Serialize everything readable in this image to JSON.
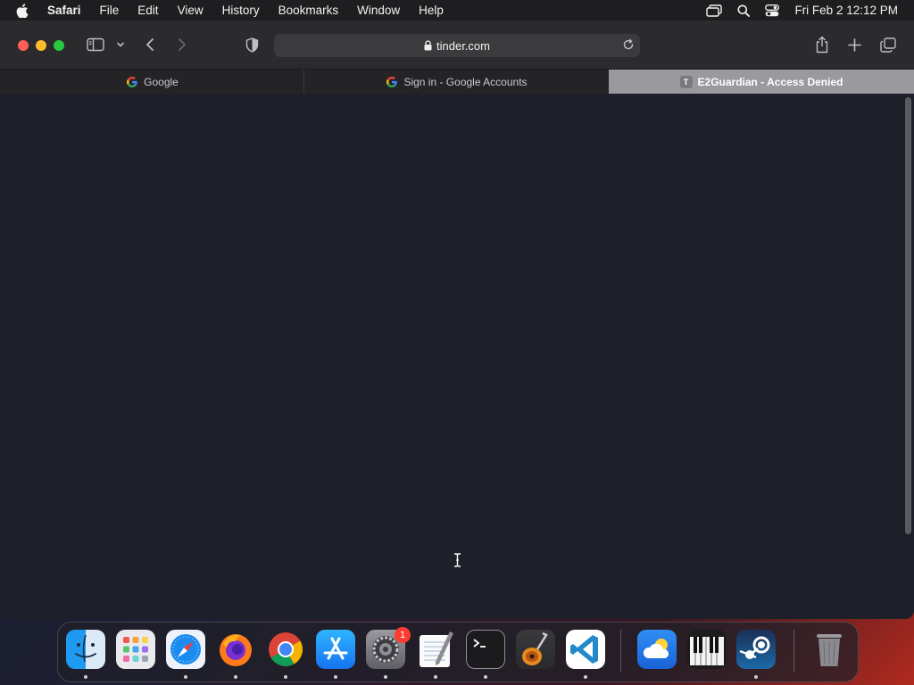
{
  "menubar": {
    "app_name": "Safari",
    "items": [
      "File",
      "Edit",
      "View",
      "History",
      "Bookmarks",
      "Window",
      "Help"
    ],
    "clock": "Fri Feb 2  12:12 PM"
  },
  "toolbar": {
    "url": "tinder.com"
  },
  "tabs": [
    {
      "title": "Google",
      "favicon": "google-icon",
      "active": false
    },
    {
      "title": "Sign in - Google Accounts",
      "favicon": "google-icon",
      "active": false
    },
    {
      "title": "E2Guardian - Access Denied",
      "favicon": "letter-t-icon",
      "favicon_letter": "T",
      "active": true
    }
  ],
  "dock": {
    "apps": [
      "Finder",
      "Launchpad",
      "Safari",
      "Firefox",
      "Chrome",
      "App Store",
      "System Settings",
      "TextEdit",
      "Terminal",
      "GarageBand",
      "VS Code",
      "Weather",
      "Piano",
      "Steam",
      "Trash"
    ],
    "system_settings_badge": "1"
  },
  "colors": {
    "close": "#ff5f57",
    "minimize": "#febc2e",
    "zoom": "#28c840",
    "page_background": "#1d2029"
  }
}
